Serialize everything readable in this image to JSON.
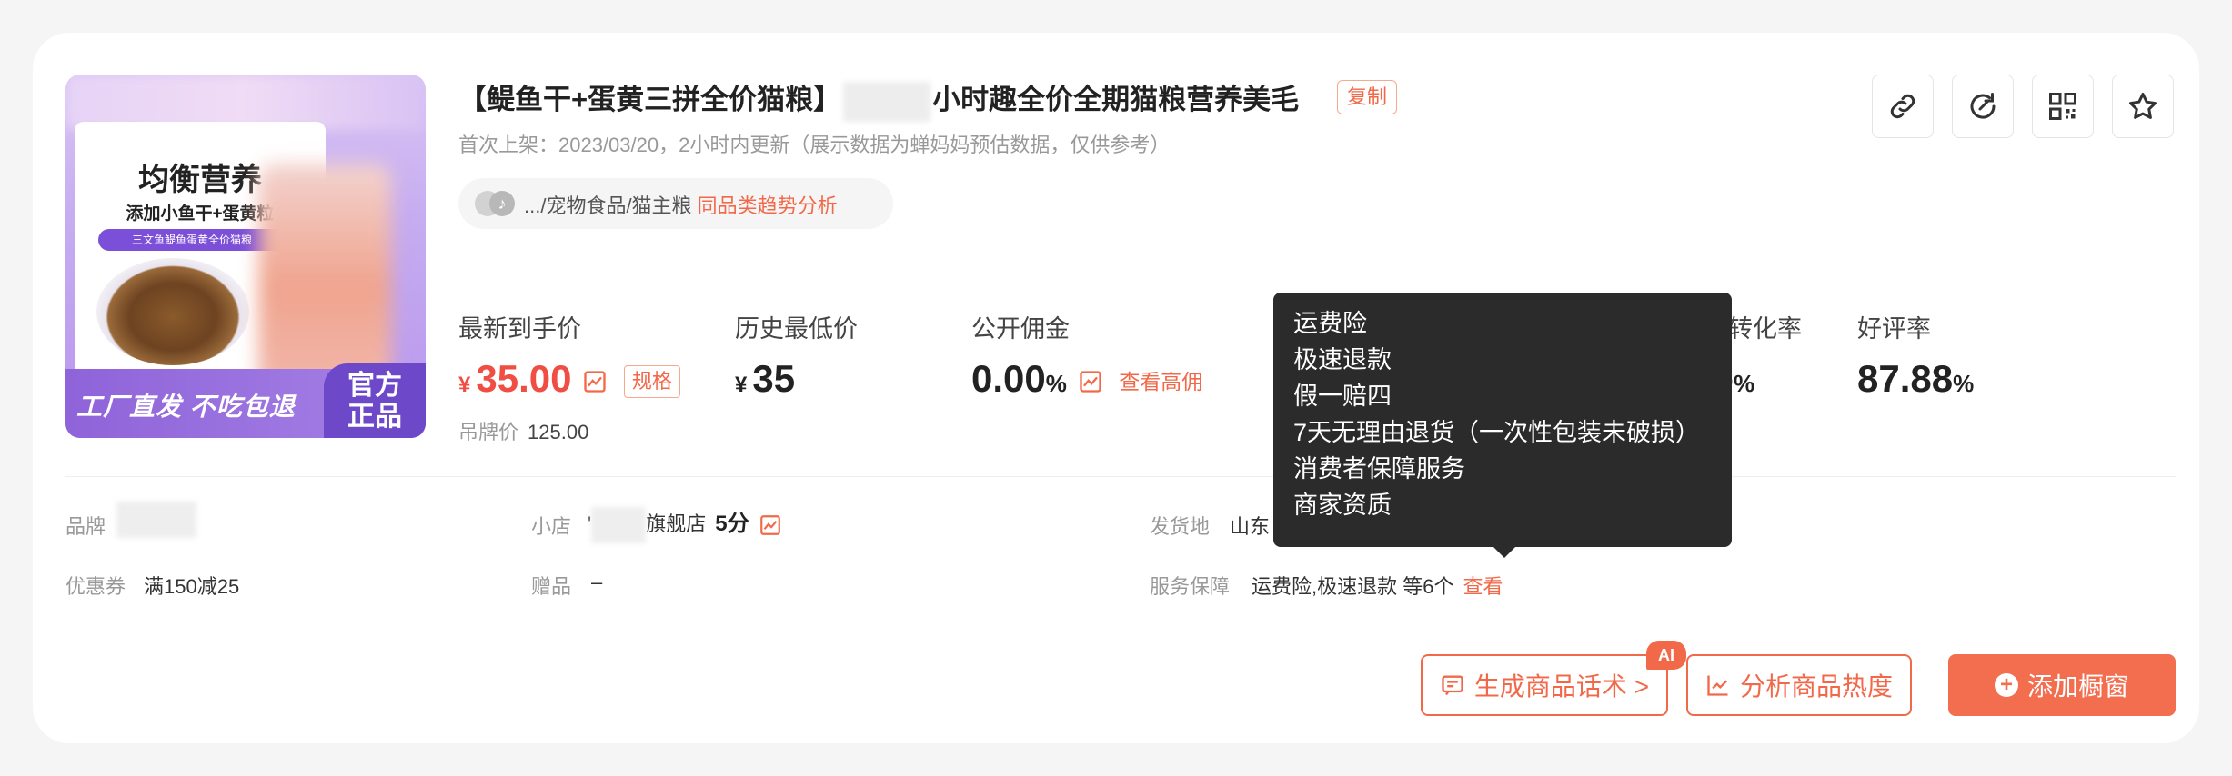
{
  "product": {
    "image_title": "均衡营养",
    "image_subtitle": "添加小鱼干+蛋黄粒",
    "image_tag": "三文鱼鳀鱼蛋黄全价猫粮",
    "image_bottom_text": "工厂直发 不吃包退",
    "image_badge_line1": "官方",
    "image_badge_line2": "正品",
    "title_part1": "【鳀鱼干+蛋黄三拼全价猫粮】",
    "title_part2": "小时趣全价全期猫粮营养美毛",
    "copy_label": "复制",
    "meta": "首次上架：2023/03/20，2小时内更新（展示数据为蝉妈妈预估数据，仅供参考）",
    "platform_icon": "douyin-icon",
    "category_path": ".../宠物食品/猫主粮",
    "category_link": "同品类趋势分析"
  },
  "actions": {
    "link_icon": "link-icon",
    "refresh_icon": "refresh-icon",
    "qr_icon": "qrcode-icon",
    "star_icon": "star-icon"
  },
  "stats": {
    "latest_price_label": "最新到手价",
    "latest_price_currency": "¥",
    "latest_price_value": "35.00",
    "spec_label": "规格",
    "original_price_label": "吊牌价",
    "original_price_value": "125.00",
    "lowest_price_label": "历史最低价",
    "lowest_price_currency": "¥",
    "lowest_price_value": "35",
    "commission_label": "公开佣金",
    "commission_value": "0.00",
    "commission_unit": "%",
    "commission_link": "查看高佣",
    "conversion_label_partial": "转化率",
    "conversion_value_partial": "-",
    "conversion_unit": "%",
    "rating_label": "好评率",
    "rating_value": "87.88",
    "rating_unit": "%"
  },
  "info": {
    "brand_label": "品牌",
    "shop_label": "小店",
    "shop_name_prefix": "'",
    "shop_name_suffix": "旗舰店",
    "shop_score": "5分",
    "origin_label": "发货地",
    "origin_value": "山东",
    "coupon_label": "优惠券",
    "coupon_value": "满150减25",
    "gift_label": "赠品",
    "gift_value": "–",
    "service_label": "服务保障",
    "service_value": "运费险,极速退款 等6个",
    "service_link": "查看"
  },
  "tooltip": {
    "items": [
      "运费险",
      "极速退款",
      "假一赔四",
      "7天无理由退货（一次性包装未破损）",
      "消费者保障服务",
      "商家资质"
    ]
  },
  "buttons": {
    "generate_label": "生成商品话术 >",
    "ai_badge": "AI",
    "analyze_label": "分析商品热度",
    "add_label": "添加橱窗"
  },
  "colors": {
    "accent": "#f2694a",
    "price_red": "#f04e44",
    "tooltip_bg": "#2b2b2b"
  }
}
